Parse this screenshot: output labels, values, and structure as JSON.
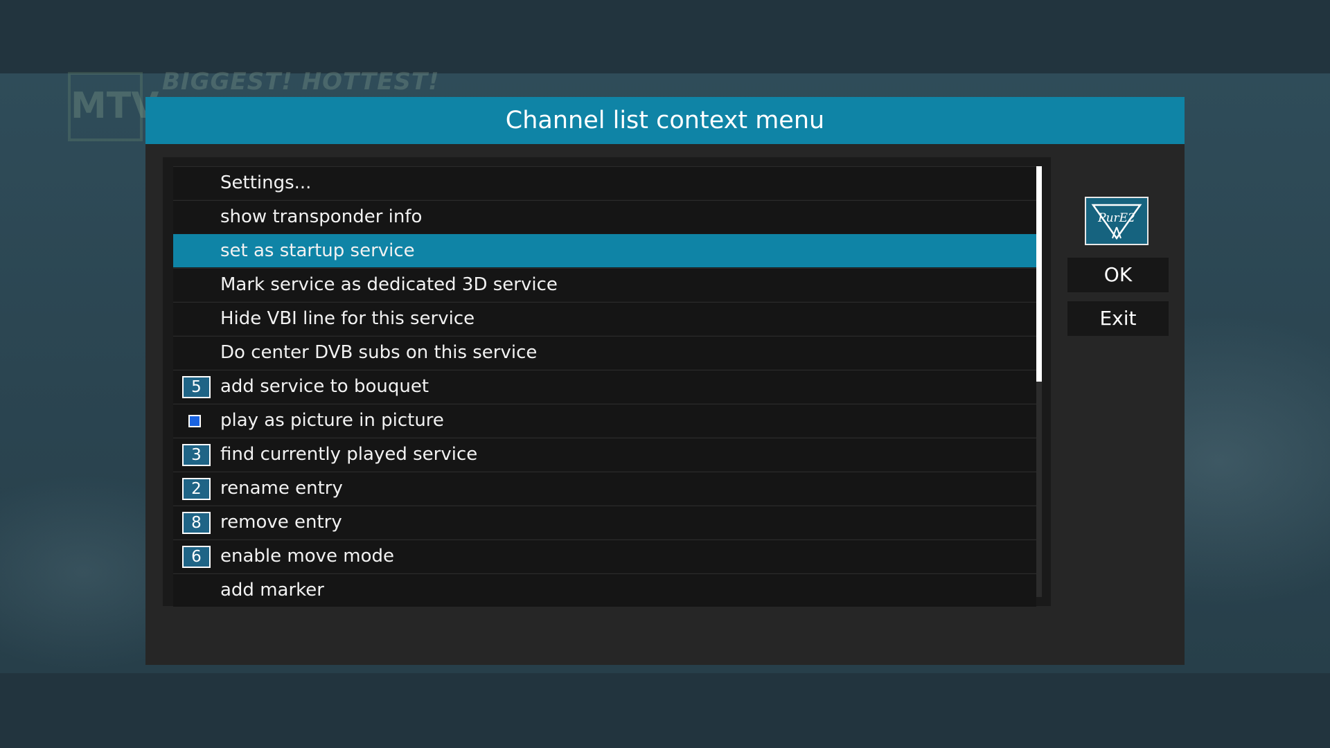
{
  "background": {
    "channel_logo_text": "MTV ROCKS",
    "headline": "BIGGEST! HOTTEST!"
  },
  "dialog": {
    "title": "Channel list context menu",
    "selected_index": 2,
    "items": [
      {
        "label": "Settings...",
        "key": null,
        "icon": null
      },
      {
        "label": "show transponder info",
        "key": null,
        "icon": null
      },
      {
        "label": "set as startup service",
        "key": null,
        "icon": null
      },
      {
        "label": "Mark service as dedicated 3D service",
        "key": null,
        "icon": null
      },
      {
        "label": "Hide VBI line for this service",
        "key": null,
        "icon": null
      },
      {
        "label": "Do center DVB subs on this service",
        "key": null,
        "icon": null
      },
      {
        "label": "add service to bouquet",
        "key": "5",
        "icon": null
      },
      {
        "label": "play as picture in picture",
        "key": null,
        "icon": "blue-square-icon"
      },
      {
        "label": "find currently played service",
        "key": "3",
        "icon": null
      },
      {
        "label": "rename entry",
        "key": "2",
        "icon": null
      },
      {
        "label": "remove entry",
        "key": "8",
        "icon": null
      },
      {
        "label": "enable move mode",
        "key": "6",
        "icon": null
      },
      {
        "label": "add marker",
        "key": null,
        "icon": null
      }
    ],
    "scroll_position_fraction": 0.5,
    "brand_logo_text": "PurE2",
    "buttons": {
      "ok": "OK",
      "exit": "Exit"
    }
  },
  "colors": {
    "accent": "#0f84a6",
    "key_badge": "#1f6486",
    "pip_blue": "#1a63e0"
  }
}
